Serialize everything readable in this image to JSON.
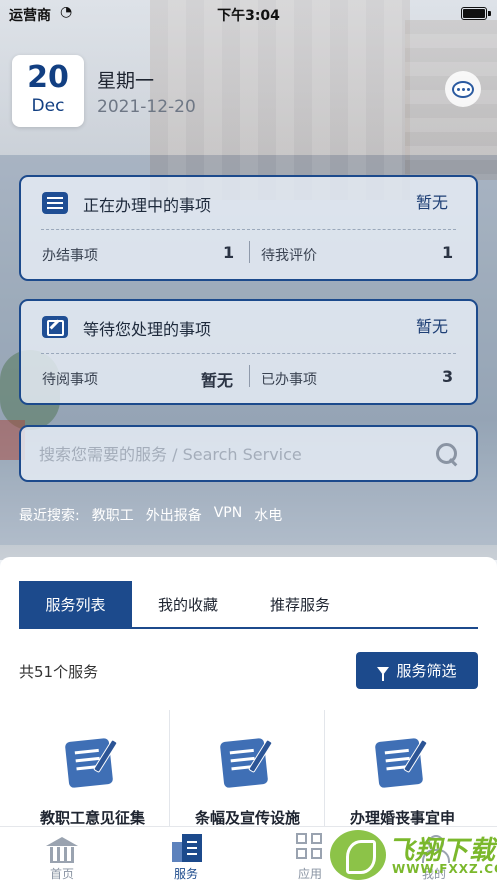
{
  "status_bar": {
    "carrier": "运营商",
    "time": "下午3:04"
  },
  "date": {
    "day": "20",
    "month": "Dec",
    "weekday": "星期一",
    "full": "2021-12-20"
  },
  "cards": [
    {
      "title": "正在办理中的事项",
      "status": "暂无",
      "left_label": "办结事项",
      "left_value": "1",
      "right_label": "待我评价",
      "right_value": "1"
    },
    {
      "title": "等待您处理的事项",
      "status": "暂无",
      "left_label": "待阅事项",
      "left_value": "暂无",
      "right_label": "已办事项",
      "right_value": "3"
    }
  ],
  "search": {
    "placeholder": "搜索您需要的服务 / Search Service"
  },
  "recent": {
    "label": "最近搜索:",
    "items": [
      "教职工",
      "外出报备",
      "VPN",
      "水电"
    ]
  },
  "tabs": [
    {
      "label": "服务列表"
    },
    {
      "label": "我的收藏"
    },
    {
      "label": "推荐服务"
    }
  ],
  "service_count": "共51个服务",
  "filter_label": "服务筛选",
  "services": [
    {
      "label": "教职工意见征集"
    },
    {
      "label": "条幅及宣传设施"
    },
    {
      "label": "办理婚丧事宜申"
    }
  ],
  "nav": [
    {
      "label": "首页"
    },
    {
      "label": "服务"
    },
    {
      "label": "应用"
    },
    {
      "label": "我的"
    }
  ],
  "watermark": {
    "text": "飞翔下载",
    "url": "WWW.FXXZ.COM"
  },
  "colors": {
    "primary": "#1c4a8c",
    "accent": "#123f82"
  }
}
